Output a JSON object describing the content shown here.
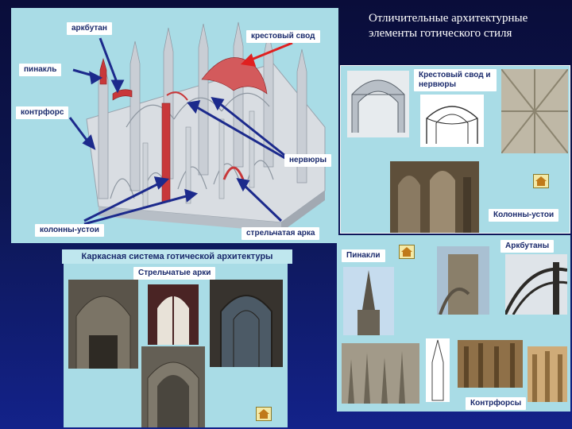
{
  "title": "Отличительные архитектурные элементы готического стиля",
  "diagram": {
    "labels": {
      "arkbutan": "аркбутан",
      "krestovy_svod": "крестовый свод",
      "pinakl": "пинакль",
      "kontrfors": "контрфорс",
      "nervyury": "нервюры",
      "kolonny_ustoi": "колонны-устои",
      "strelchataya_arka": "стрельчатая арка"
    },
    "caption": "Каркасная система готической архитектуры"
  },
  "panel_vault": {
    "heading": "Крестовый свод и нервюры",
    "columns_label": "Колонны-устои"
  },
  "panel_arches": {
    "heading": "Стрельчатые арки"
  },
  "panel_pinnacles": {
    "pinnacles_label": "Пинакли",
    "flying_buttresses_label": "Аркбутаны",
    "buttresses_label": "Контрфорсы"
  },
  "colors": {
    "panel_bg": "#a9dce6",
    "label_text": "#1a2a6c",
    "arrow_blue": "#1c2a8c",
    "arrow_red": "#e02020",
    "highlight_red": "#c8383a"
  }
}
